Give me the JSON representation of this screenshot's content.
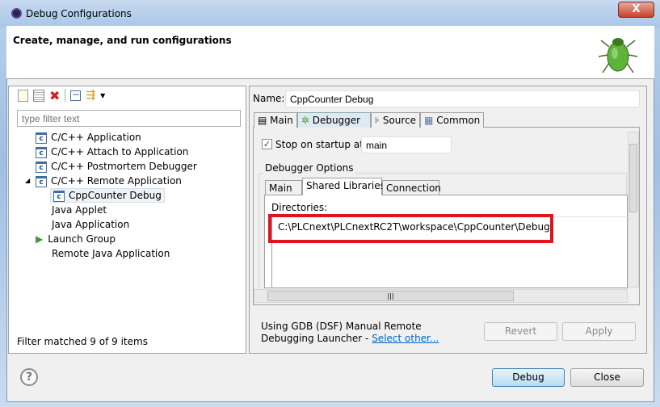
{
  "window": {
    "title": "Debug Configurations",
    "close_label": "X"
  },
  "header": {
    "title": "Create, manage, and run configurations",
    "icon": "bug-icon"
  },
  "left": {
    "toolbar": [
      "new-configuration-icon",
      "duplicate-icon",
      "delete-icon",
      "collapse-all-icon",
      "filter-icon"
    ],
    "filter_placeholder": "type filter text",
    "tree": [
      {
        "label": "C/C++ Application",
        "icon": "c-config-icon",
        "level": 0
      },
      {
        "label": "C/C++ Attach to Application",
        "icon": "c-config-icon",
        "level": 0
      },
      {
        "label": "C/C++ Postmortem Debugger",
        "icon": "c-config-icon",
        "level": 0
      },
      {
        "label": "C/C++ Remote Application",
        "icon": "c-config-icon",
        "level": 0,
        "expanded": true
      },
      {
        "label": "CppCounter Debug",
        "icon": "c-config-icon",
        "level": 1,
        "selected": true
      },
      {
        "label": "Java Applet",
        "level": 0
      },
      {
        "label": "Java Application",
        "level": 0
      },
      {
        "label": "Launch Group",
        "icon": "play-icon",
        "level": 0
      },
      {
        "label": "Remote Java Application",
        "level": 0
      }
    ],
    "status": "Filter matched 9 of 9 items"
  },
  "right": {
    "name_label": "Name:",
    "name_value": "CppCounter Debug",
    "tabs": [
      {
        "label": "Main"
      },
      {
        "label": "Debugger",
        "active": true
      },
      {
        "label": "Source"
      },
      {
        "label": "Common"
      }
    ],
    "stop_label": "Stop on startup at:",
    "stop_checked": true,
    "stop_value": "main",
    "group_label": "Debugger Options",
    "inner_tabs": [
      {
        "label": "Main"
      },
      {
        "label": "Shared Libraries",
        "active": true
      },
      {
        "label": "Connection"
      }
    ],
    "directories_label": "Directories:",
    "directories": [
      "C:\\PLCnext\\PLCnextRC2T\\workspace\\CppCounter\\Debug"
    ],
    "highlight_color": "#e0141e",
    "launcher_text": "Using GDB (DSF) Manual Remote Debugging Launcher - ",
    "launcher_link": "Select other...",
    "revert": "Revert",
    "apply": "Apply"
  },
  "footer": {
    "debug": "Debug",
    "close": "Close"
  }
}
